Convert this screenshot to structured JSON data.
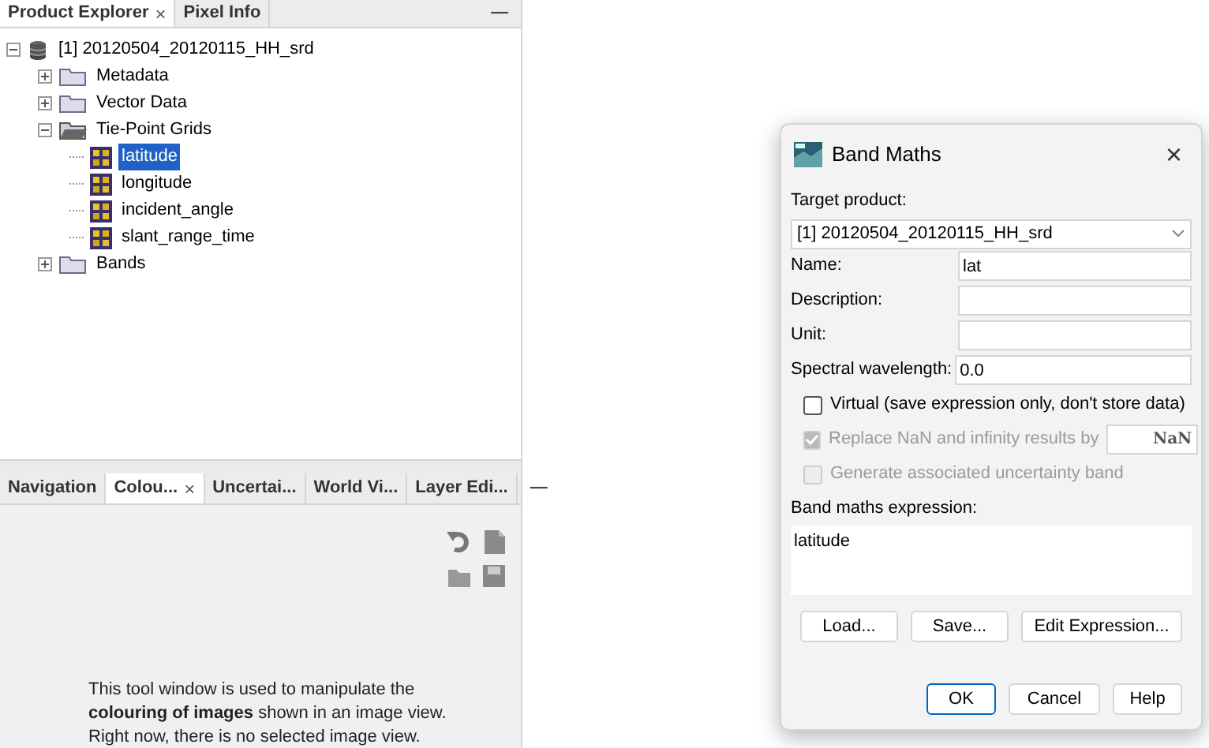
{
  "explorer": {
    "tabs": [
      {
        "label": "Product Explorer",
        "selected": true,
        "close": "×"
      },
      {
        "label": "Pixel Info",
        "selected": false
      }
    ],
    "minimize": "—",
    "tree": [
      {
        "label": "[1] 20120504_20120115_HH_srd",
        "kind": "product",
        "expanded": true,
        "selected": false,
        "children": [
          {
            "label": "Metadata",
            "kind": "folder",
            "expanded": false,
            "selected": false
          },
          {
            "label": "Vector Data",
            "kind": "folder",
            "expanded": false,
            "selected": false
          },
          {
            "label": "Tie-Point Grids",
            "kind": "folder",
            "expanded": true,
            "selected": false,
            "children": [
              {
                "label": "latitude",
                "kind": "grid",
                "selected": true
              },
              {
                "label": "longitude",
                "kind": "grid",
                "selected": false
              },
              {
                "label": "incident_angle",
                "kind": "grid",
                "selected": false
              },
              {
                "label": "slant_range_time",
                "kind": "grid",
                "selected": false
              }
            ]
          },
          {
            "label": "Bands",
            "kind": "folder",
            "expanded": false,
            "selected": false
          }
        ]
      }
    ]
  },
  "tool_panel": {
    "tabs": [
      {
        "label": "Navigation",
        "selected": false
      },
      {
        "label": "Colou...",
        "selected": true,
        "close": "×"
      },
      {
        "label": "Uncertai...",
        "selected": false
      },
      {
        "label": "World Vi...",
        "selected": false
      },
      {
        "label": "Layer Edi...",
        "selected": false
      }
    ],
    "minimize": "—",
    "message": "This tool window is used to manipulate the **colouring of images** shown in an image view. Right now, there is no selected image view."
  },
  "dialog": {
    "title": "Band Maths",
    "close": "×",
    "target_label": "Target product:",
    "target_value": "[1] 20120504_20120115_HH_srd",
    "fields": [
      {
        "label": "Name:",
        "value": "lat"
      },
      {
        "label": "Description:"
      },
      {
        "label": "Unit:"
      },
      {
        "label": "Spectral wavelength:",
        "value": "0.0"
      }
    ],
    "options": [
      {
        "label": "Virtual (save expression only, don't store data)",
        "checked": false,
        "disabled": false
      },
      {
        "label": "Replace NaN and infinity results by",
        "checked": true,
        "disabled": true,
        "value": "NaN"
      },
      {
        "label": "Generate associated uncertainty band",
        "checked": false,
        "disabled": true
      }
    ],
    "expression_label": "Band maths expression:",
    "expression": "latitude",
    "tool_buttons": [
      "Load...",
      "Save...",
      "Edit Expression..."
    ],
    "buttons": [
      {
        "label": "OK",
        "default": true
      },
      {
        "label": "Cancel",
        "default": false
      },
      {
        "label": "Help",
        "default": false
      }
    ]
  }
}
